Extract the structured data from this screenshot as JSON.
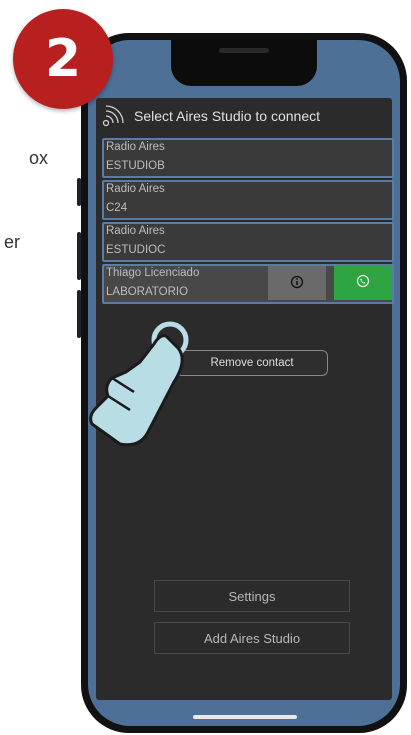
{
  "step_number": "2",
  "background_text": [
    "ox",
    "er"
  ],
  "app": {
    "header_title": "Select Aires Studio to connect",
    "contacts": [
      {
        "line1": "Radio Aires",
        "line2": "ESTUDIOB"
      },
      {
        "line1": "Radio Aires",
        "line2": "C24"
      },
      {
        "line1": "Radio Aires",
        "line2": "ESTUDIOC"
      },
      {
        "line1": "Thiago Licenciado",
        "line2": "LABORATORIO"
      }
    ],
    "context_menu_remove": "Remove contact",
    "settings_label": "Settings",
    "add_studio_label": "Add Aires Studio"
  },
  "colors": {
    "badge": "#b81f1f",
    "call_button": "#2ea442",
    "contact_border": "#5b7ca5",
    "phone_screen_bg": "#4e6f96"
  }
}
